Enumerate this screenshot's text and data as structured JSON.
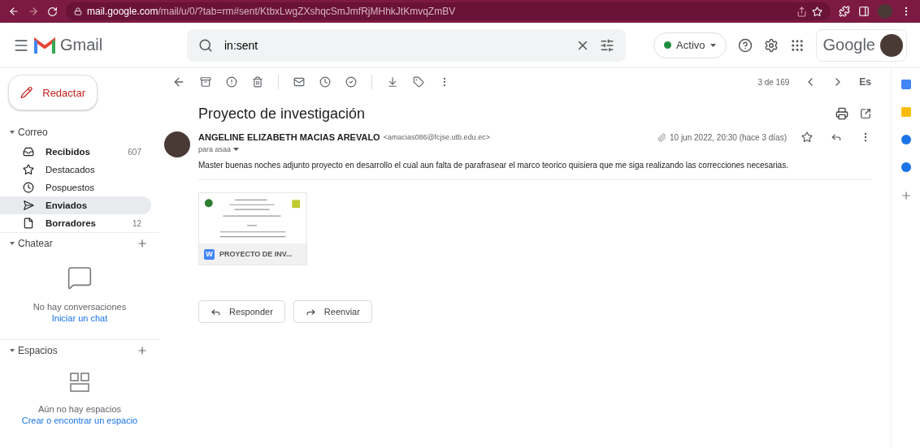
{
  "browser": {
    "url_host": "mail.google.com",
    "url_path": "/mail/u/0/?tab=rm#sent/KtbxLwgZXshqcSmJmfRjMHhkJtKmvqZmBV"
  },
  "header": {
    "app_name": "Gmail",
    "search": {
      "value": "in:sent"
    },
    "status": {
      "label": "Activo",
      "color": "#1e8e3e"
    },
    "brand": "Google"
  },
  "compose": {
    "label": "Redactar"
  },
  "sections": [
    {
      "title": "Correo",
      "expanded": true,
      "kind": "mail",
      "items": [
        {
          "label": "Recibidos",
          "count": "607",
          "bold": true,
          "selected": false
        },
        {
          "label": "Destacados",
          "bold": false,
          "selected": false
        },
        {
          "label": "Pospuestos",
          "bold": false,
          "selected": false
        },
        {
          "label": "Enviados",
          "bold": true,
          "selected": true
        },
        {
          "label": "Borradores",
          "count": "12",
          "bold": true,
          "selected": false
        }
      ]
    },
    {
      "title": "Chatear",
      "expanded": true,
      "kind": "chat",
      "empty": "No hay conversaciones",
      "link": "Iniciar un chat"
    },
    {
      "title": "Espacios",
      "expanded": true,
      "kind": "spaces",
      "empty": "Aún no hay espacios",
      "link": "Crear o encontrar un espacio"
    }
  ],
  "toolbar": {
    "pager": "3 de 169",
    "lang": "Es"
  },
  "message": {
    "subject": "Proyecto de investigación",
    "sender": "ANGELINE ELIZABETH MACIAS AREVALO",
    "email": "<amacias086@fcjse.utb.edu.ec>",
    "to": "para asaa",
    "date": "10 jun 2022, 20:30 (hace 3 días)",
    "starred": false,
    "body": "Master buenas noches adjunto proyecto en desarrollo el cual aun falta de parafrasear el marco teorico quisiera que me siga realizando las correcciones necesarias.",
    "attachment": {
      "name": "PROYECTO DE INV...",
      "type": "W"
    }
  },
  "actions": [
    {
      "label": "Responder",
      "kind": "reply"
    },
    {
      "label": "Reenviar",
      "kind": "forward"
    }
  ]
}
